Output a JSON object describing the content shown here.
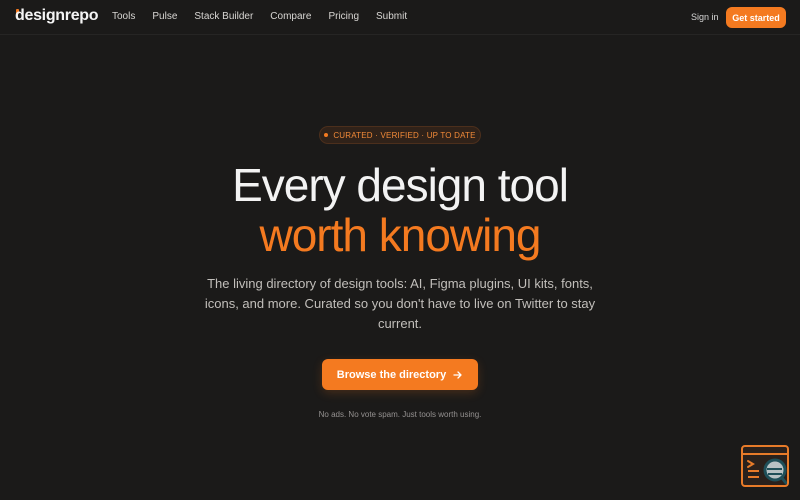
{
  "logo": {
    "text": "designrepo",
    "icon": "designrepo-logo-icon"
  },
  "nav": {
    "links": [
      "Tools",
      "Pulse",
      "Stack Builder",
      "Compare",
      "Pricing",
      "Submit"
    ],
    "sign_in": "Sign in",
    "get_started": "Get started"
  },
  "hero": {
    "badge": "CURATED · VERIFIED · UP TO DATE",
    "headline_1": "Every design tool",
    "headline_2": "worth knowing",
    "description": "The living directory of design tools: AI, Figma plugins, UI kits, fonts, icons, and more. Curated so you don't have to live on Twitter to stay current.",
    "cta": "Browse the directory",
    "note": "No ads. No vote spam. Just tools worth using."
  },
  "colors": {
    "background": "#1b1a19",
    "accent": "#f47a20",
    "text": "#f3f3f3",
    "muted": "#c2bfbb"
  },
  "icons": {
    "arrow": "arrow-right-icon",
    "widget": "terminal-search-icon"
  }
}
